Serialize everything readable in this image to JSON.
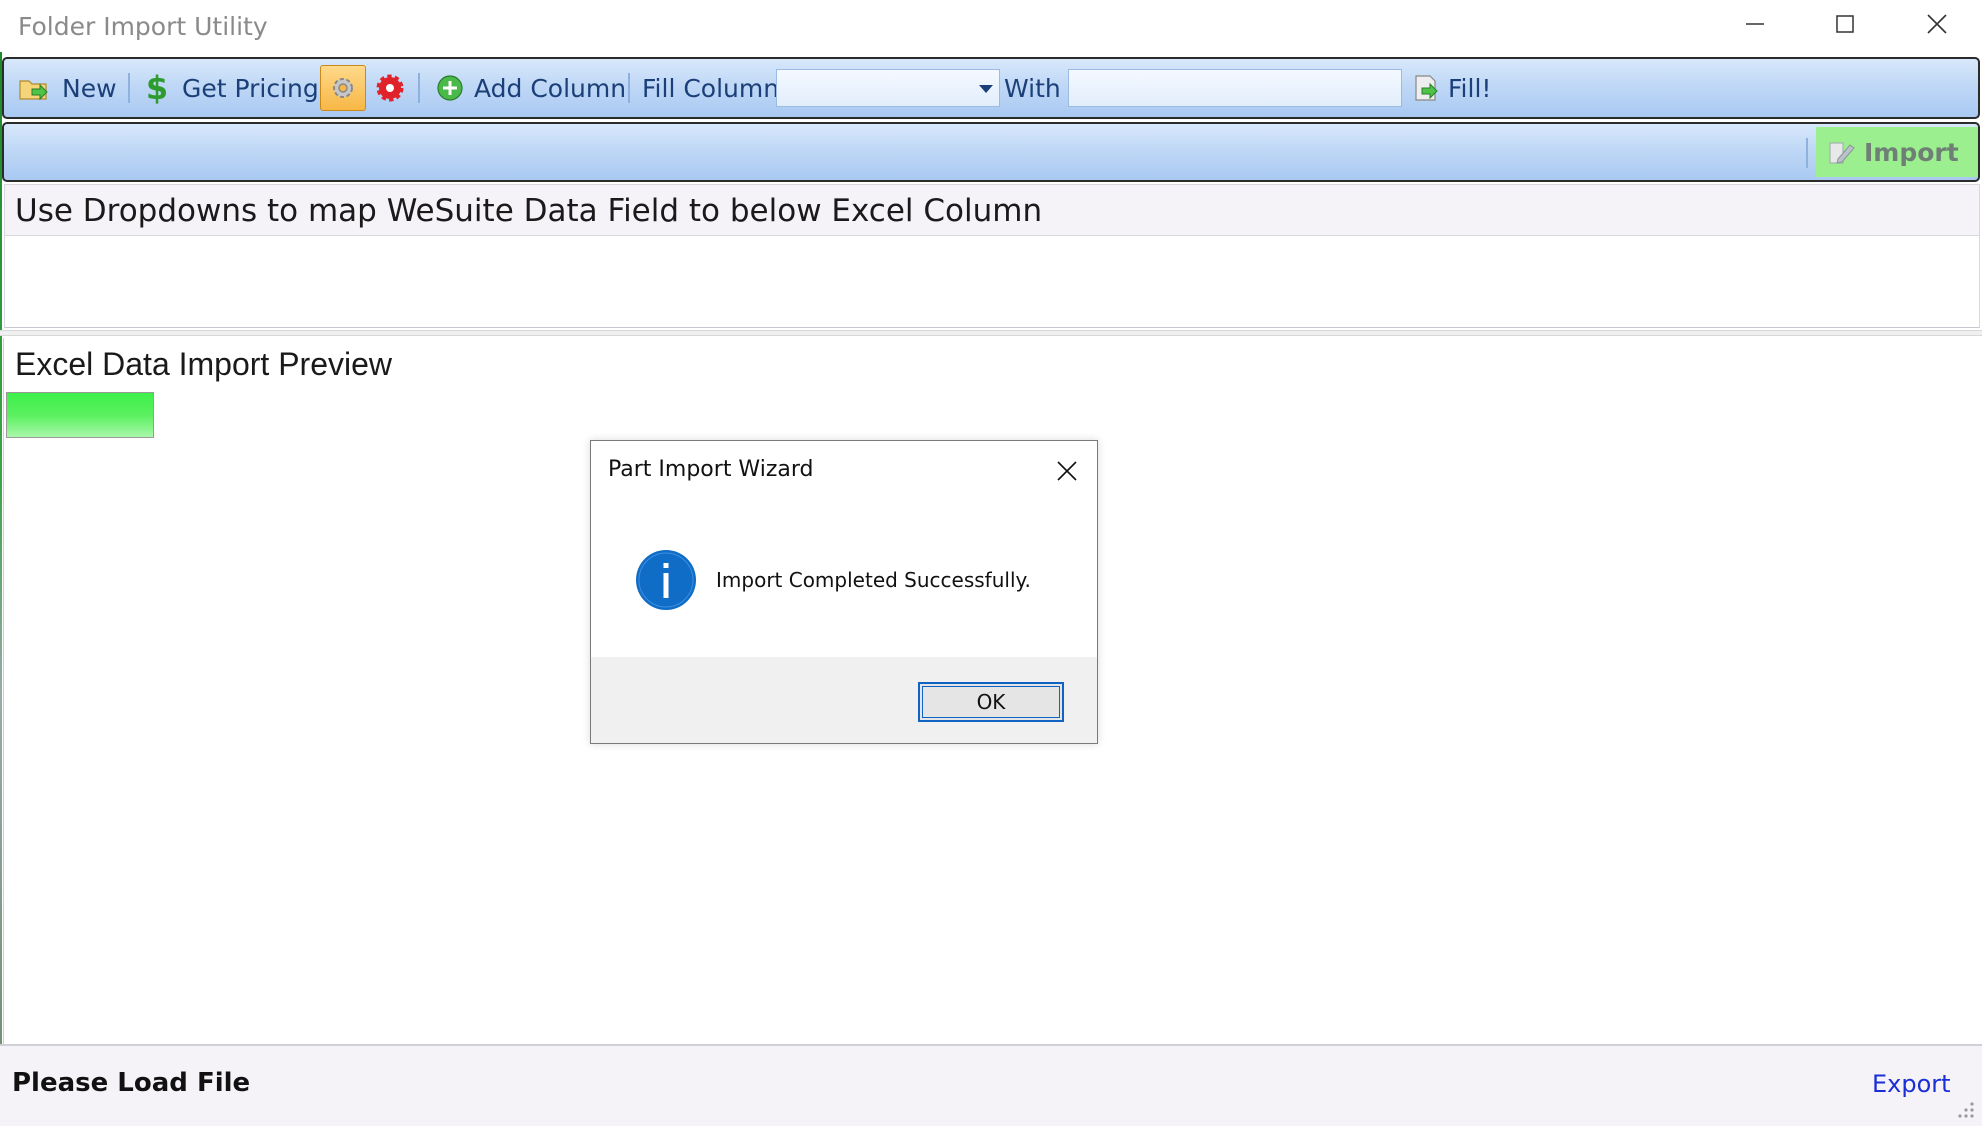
{
  "window": {
    "title": "Folder Import Utility"
  },
  "toolbar": {
    "new_label": "New",
    "get_pricing_label": "Get Pricing",
    "add_column_label": "Add Column",
    "fill_column_label": "Fill Column",
    "fill_column_value": "",
    "with_label": "With",
    "with_value": "",
    "fill_label": "Fill!",
    "icons": {
      "new": "folder-arrow-icon",
      "get_pricing": "dollar-icon",
      "settings": "gear-icon",
      "settings_alt": "red-gear-icon",
      "add_column": "plus-circle-icon",
      "fill": "document-arrow-icon"
    }
  },
  "toolbar2": {
    "import_label": "Import",
    "import_icon": "pencil-icon"
  },
  "mapping": {
    "header": "Use Dropdowns to map WeSuite Data Field to below Excel Column"
  },
  "preview": {
    "title": "Excel Data Import Preview"
  },
  "status": {
    "text": "Please Load File",
    "export_label": "Export"
  },
  "dialog": {
    "title": "Part Import Wizard",
    "message": "Import Completed Successfully.",
    "ok_label": "OK",
    "icon": "info-icon"
  },
  "colors": {
    "toolbar_text": "#1b3f78",
    "import_bg": "#9bef8e",
    "progress_green": "#3df04a",
    "link_blue": "#1a2fd6",
    "info_blue": "#0f6cc7"
  }
}
